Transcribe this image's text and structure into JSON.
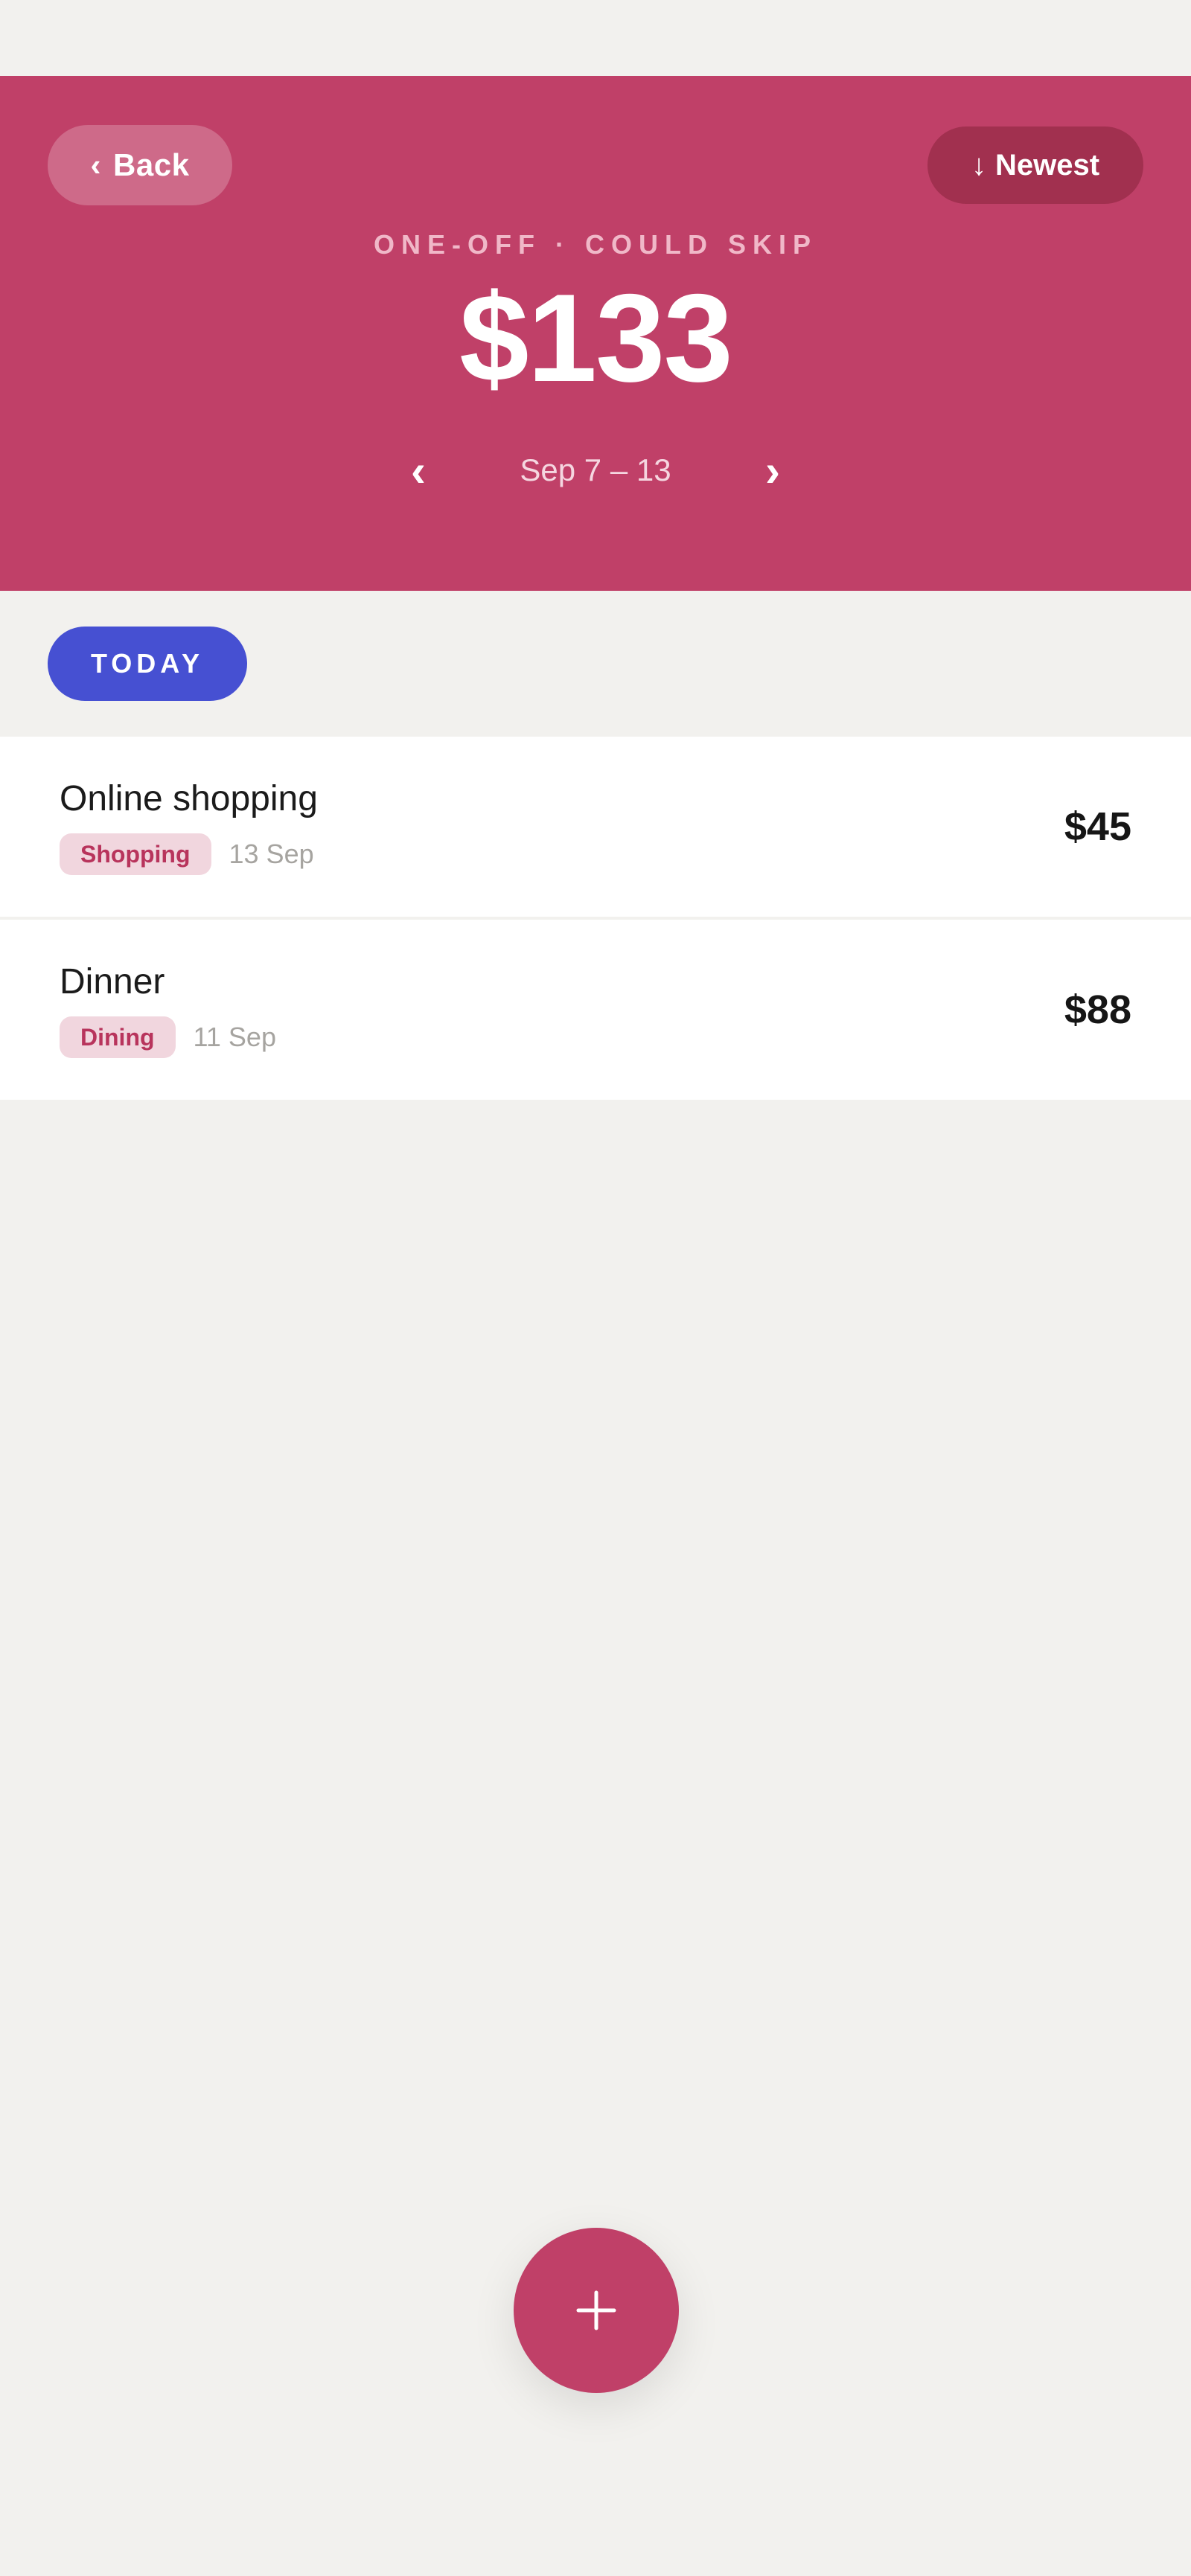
{
  "header": {
    "back_label": "Back",
    "back_icon": "chevron-left-icon",
    "sort_label": "Newest",
    "sort_icon": "arrow-down-icon",
    "eyebrow": "ONE-OFF · COULD SKIP",
    "total": "$133",
    "range": "Sep 7 – 13",
    "prev_icon": "chevron-left-icon",
    "next_icon": "chevron-right-icon",
    "accent_color": "#c04068"
  },
  "filter": {
    "today_label": "TODAY",
    "color": "#4650d2"
  },
  "transactions": [
    {
      "title": "Online shopping",
      "category": "Shopping",
      "date": "13 Sep",
      "amount": "$45"
    },
    {
      "title": "Dinner",
      "category": "Dining",
      "date": "11 Sep",
      "amount": "$88"
    }
  ],
  "fab": {
    "icon": "plus-icon"
  }
}
